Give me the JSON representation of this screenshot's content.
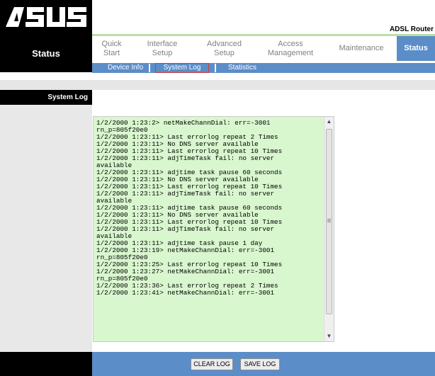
{
  "header": {
    "logo_alt": "ASUS",
    "product": "ADSL Router"
  },
  "nav": {
    "section": "Status",
    "tabs": [
      {
        "label": "Quick\nStart",
        "active": false
      },
      {
        "label": "Interface\nSetup",
        "active": false
      },
      {
        "label": "Advanced\nSetup",
        "active": false
      },
      {
        "label": "Access\nManagement",
        "active": false
      },
      {
        "label": "Maintenance",
        "active": false
      },
      {
        "label": "Status",
        "active": true
      }
    ],
    "subtabs": [
      {
        "label": "Device Info",
        "selected": false
      },
      {
        "label": "System Log",
        "selected": true
      },
      {
        "label": "Statistics",
        "selected": false
      }
    ]
  },
  "page": {
    "section_label": "System Log"
  },
  "log": {
    "lines": [
      "1/2/2000 1:23:2> netMakeChannDial: err=-3001",
      "rn_p=805f20e0",
      "1/2/2000 1:23:11> Last errorlog repeat 2 Times",
      "1/2/2000 1:23:11> No DNS server available",
      "1/2/2000 1:23:11> Last errorlog repeat 10 Times",
      "1/2/2000 1:23:11> adjTimeTask fail: no server",
      "available",
      "1/2/2000 1:23:11> adjtime task pause 60 seconds",
      "1/2/2000 1:23:11> No DNS server available",
      "1/2/2000 1:23:11> Last errorlog repeat 10 Times",
      "1/2/2000 1:23:11> adjTimeTask fail: no server",
      "available",
      "1/2/2000 1:23:11> adjtime task pause 60 seconds",
      "1/2/2000 1:23:11> No DNS server available",
      "1/2/2000 1:23:11> Last errorlog repeat 10 Times",
      "1/2/2000 1:23:11> adjTimeTask fail: no server",
      "available",
      "1/2/2000 1:23:11> adjtime task pause 1 day",
      "1/2/2000 1:23:19> netMakeChannDial: err=-3001",
      "rn_p=805f20e0",
      "1/2/2000 1:23:25> Last errorlog repeat 10 Times",
      "1/2/2000 1:23:27> netMakeChannDial: err=-3001",
      "rn_p=805f20e0",
      "1/2/2000 1:23:36> Last errorlog repeat 2 Times",
      "1/2/2000 1:23:41> netMakeChannDial: err=-3001"
    ]
  },
  "buttons": {
    "clear": "CLEAR LOG",
    "save": "SAVE LOG"
  },
  "icons": {
    "scroll_up": "scroll-up-arrow",
    "scroll_down": "scroll-down-arrow"
  },
  "colors": {
    "brand_blue": "#5b8dc8",
    "log_bg": "#d9f7cf",
    "accent_green": "#b9dfa9",
    "selection_red": "#d23a3a"
  }
}
